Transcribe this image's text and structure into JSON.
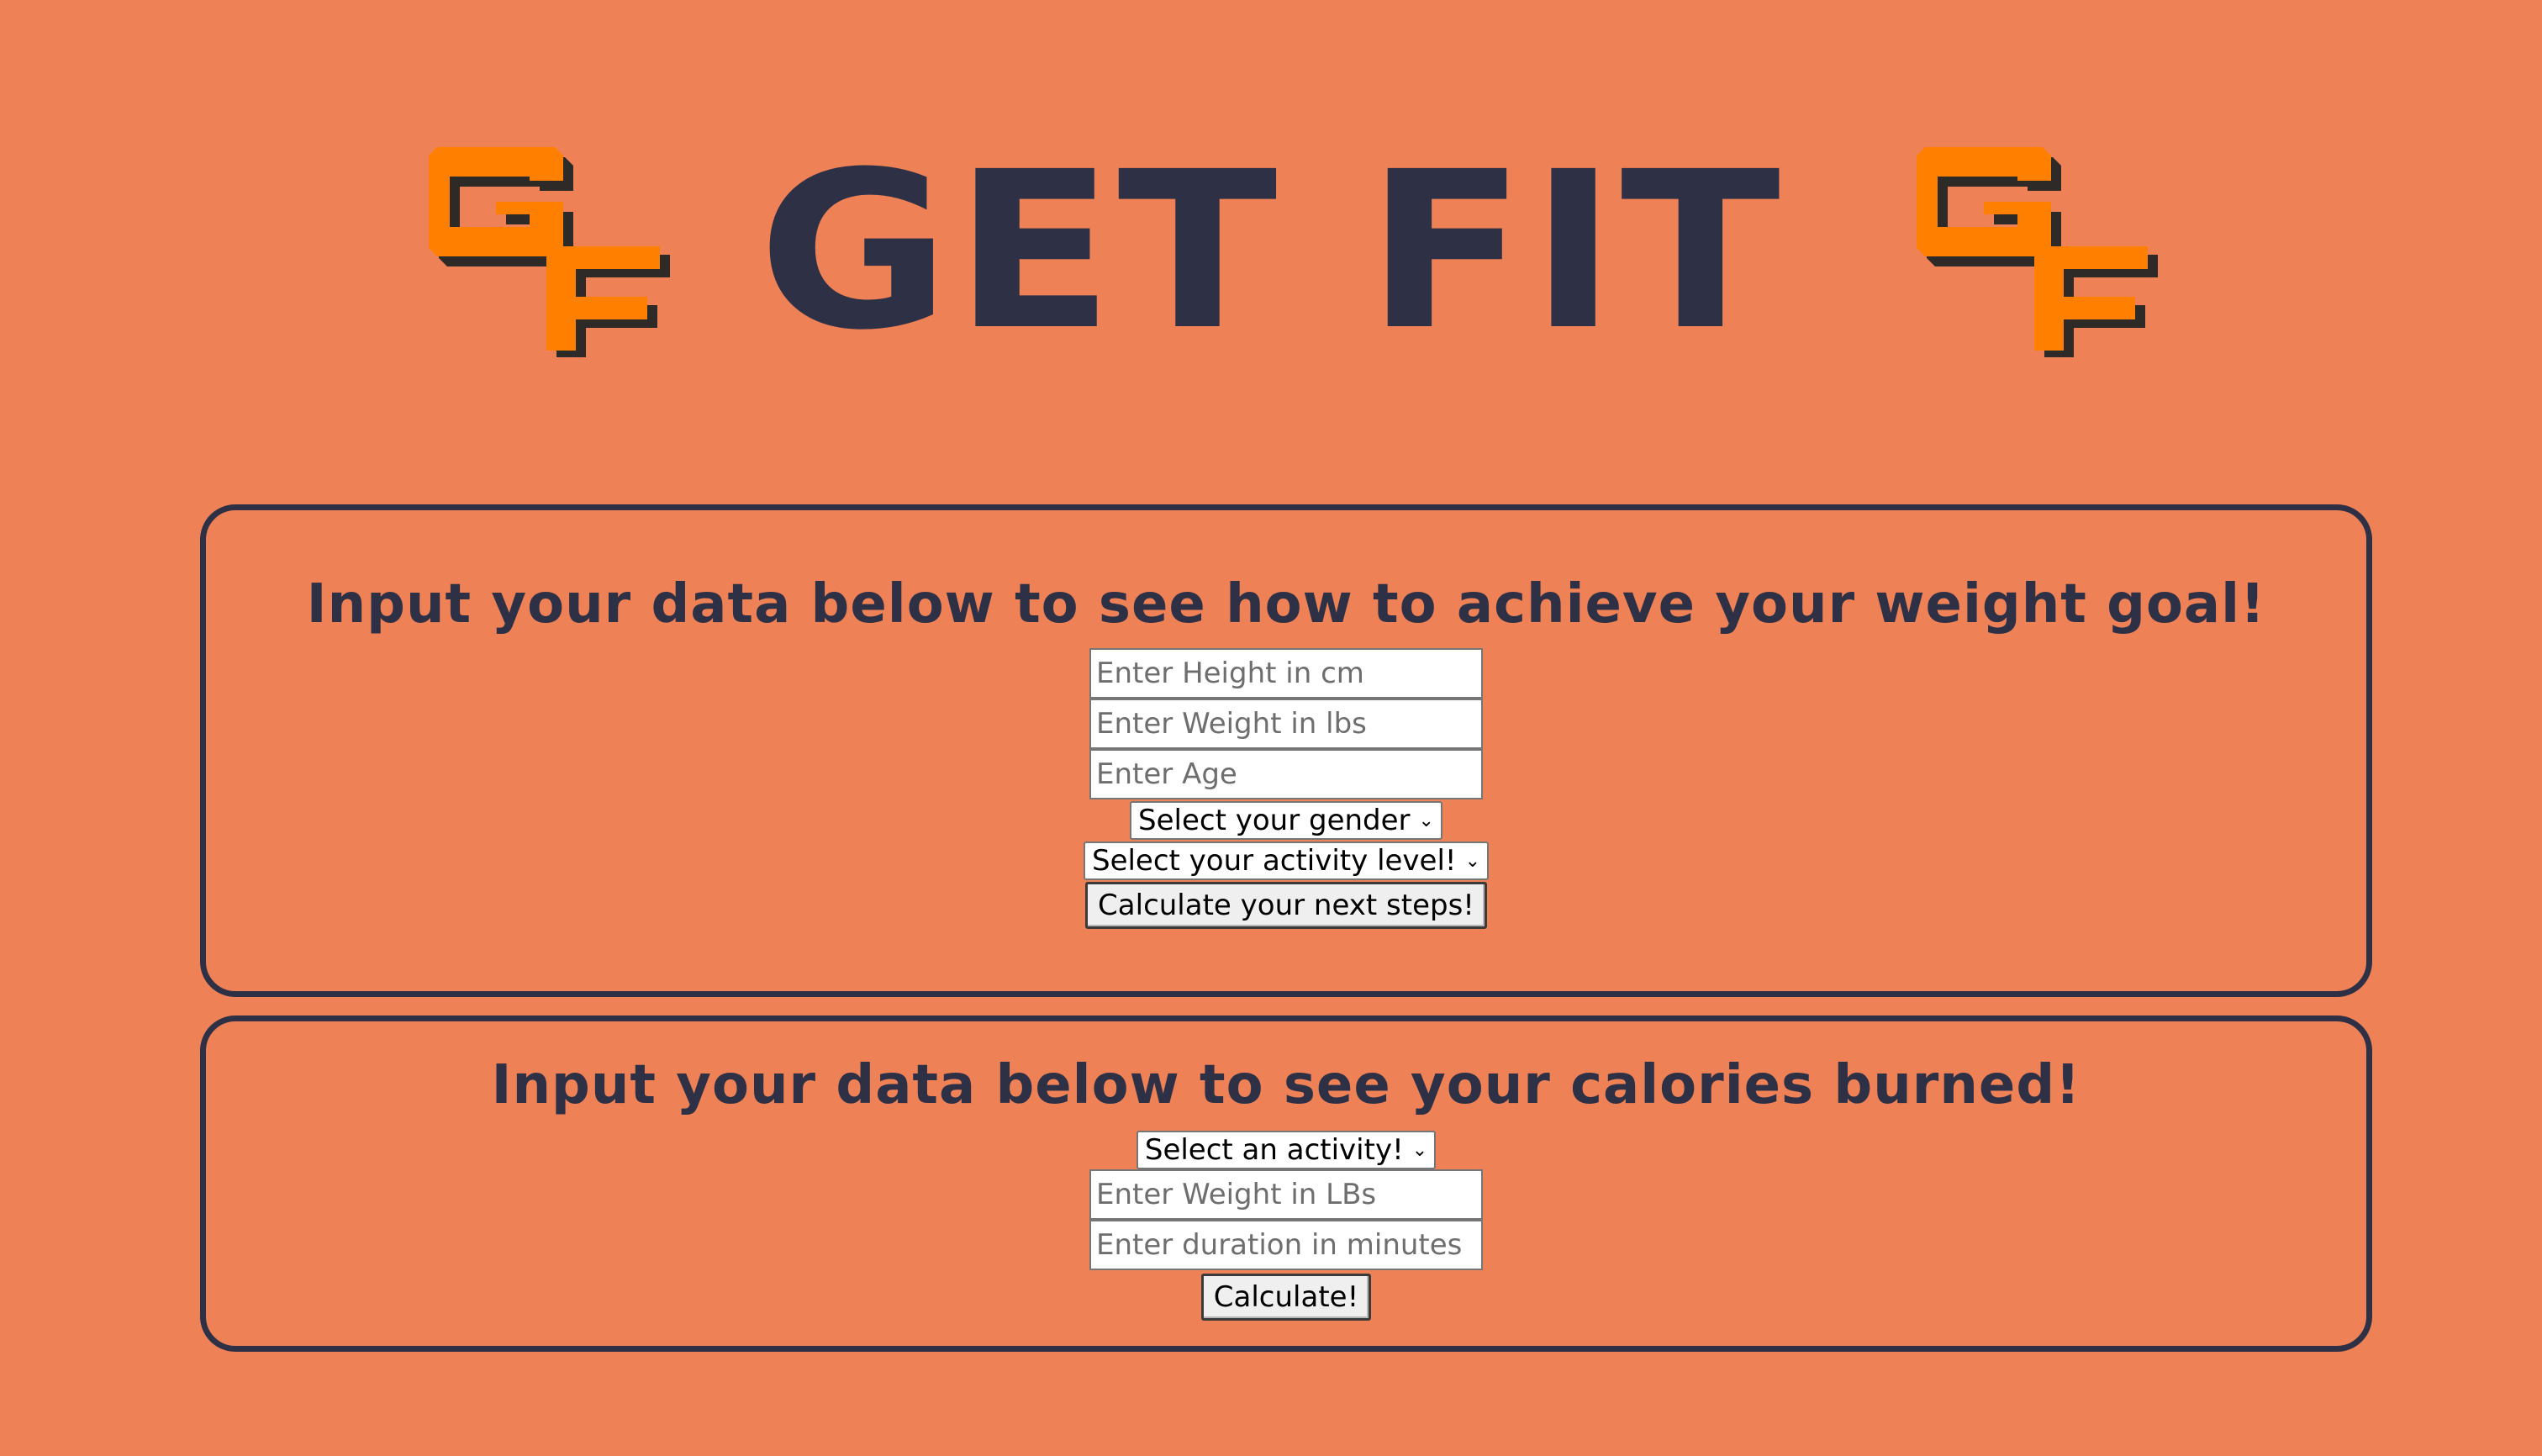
{
  "header": {
    "title": "GET FIT",
    "logo_text": "GF"
  },
  "colors": {
    "background": "#ef8157",
    "accent_orange": "#ff7f00",
    "dark_navy": "#2e3145"
  },
  "goal_section": {
    "heading": "Input your data below to see how to achieve your weight goal!",
    "height_placeholder": "Enter Height in cm",
    "weight_placeholder": "Enter Weight in lbs",
    "age_placeholder": "Enter Age",
    "gender_select": "Select your gender",
    "activity_select": "Select your activity level!",
    "submit_label": "Calculate your next steps!"
  },
  "burn_section": {
    "heading": "Input your data below to see your calories burned!",
    "activity_select": "Select an activity!",
    "weight_placeholder": "Enter Weight in LBs",
    "duration_placeholder": "Enter duration in minutes",
    "submit_label": "Calculate!"
  }
}
